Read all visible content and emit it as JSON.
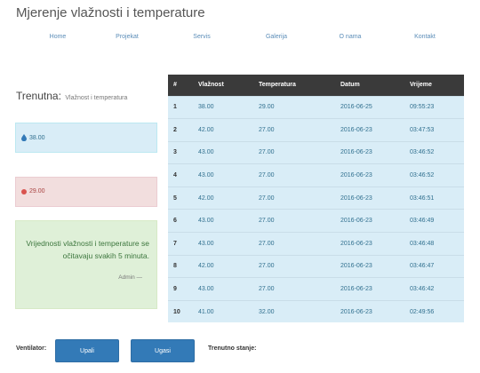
{
  "app": {
    "title": "Mjerenje vlažnosti i temperature"
  },
  "nav": [
    {
      "label": "Home"
    },
    {
      "label": "Projekat"
    },
    {
      "label": "Servis"
    },
    {
      "label": "Galerija"
    },
    {
      "label": "O nama"
    },
    {
      "label": "Kontakt"
    }
  ],
  "current": {
    "title": "Trenutna:",
    "subtitle": "Vlažnost i temperatura",
    "humidity": "38.00",
    "temperature": "29.00",
    "info": "Vrijednosti vlažnosti i temperature se očitavaju svakih 5 minuta.",
    "author": "Admin —",
    "colors": {
      "humidity_icon": "#337ab7",
      "temperature_icon": "#d9534f"
    }
  },
  "table": {
    "headers": [
      "#",
      "Vlažnost",
      "Temperatura",
      "Datum",
      "Vrijeme"
    ],
    "rows": [
      [
        "1",
        "38.00",
        "29.00",
        "2016-06-25",
        "09:55:23"
      ],
      [
        "2",
        "42.00",
        "27.00",
        "2016-06-23",
        "03:47:53"
      ],
      [
        "3",
        "43.00",
        "27.00",
        "2016-06-23",
        "03:46:52"
      ],
      [
        "4",
        "43.00",
        "27.00",
        "2016-06-23",
        "03:46:52"
      ],
      [
        "5",
        "42.00",
        "27.00",
        "2016-06-23",
        "03:46:51"
      ],
      [
        "6",
        "43.00",
        "27.00",
        "2016-06-23",
        "03:46:49"
      ],
      [
        "7",
        "43.00",
        "27.00",
        "2016-06-23",
        "03:46:48"
      ],
      [
        "8",
        "42.00",
        "27.00",
        "2016-06-23",
        "03:46:47"
      ],
      [
        "9",
        "43.00",
        "27.00",
        "2016-06-23",
        "03:46:42"
      ],
      [
        "10",
        "41.00",
        "32.00",
        "2016-06-23",
        "02:49:56"
      ]
    ]
  },
  "controls": {
    "ventilator_label": "Ventilator:",
    "on_label": "Upali",
    "off_label": "Ugasi",
    "state_label": "Trenutno stanje:"
  }
}
